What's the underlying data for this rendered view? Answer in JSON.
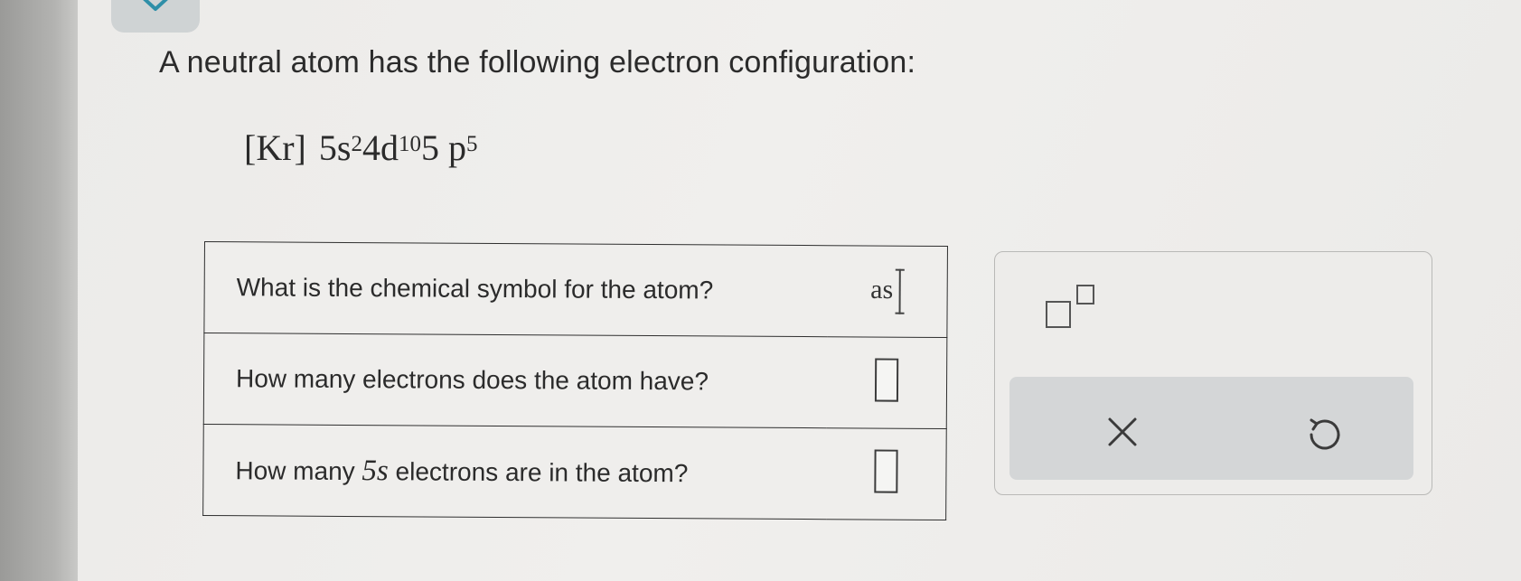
{
  "header": {
    "collapse_icon": "chevron-down-icon"
  },
  "question": {
    "prompt": "A neutral atom has the following electron configuration:",
    "configuration": {
      "core": "[Kr]",
      "orbitals": [
        {
          "label": "5s",
          "exponent": "2"
        },
        {
          "label": "4d",
          "exponent": "10"
        },
        {
          "label": "5 p",
          "exponent": "5"
        }
      ]
    }
  },
  "table": {
    "rows": [
      {
        "question": "What is the chemical symbol for the atom?",
        "answer": "as"
      },
      {
        "question": "How many electrons does the atom have?",
        "answer": ""
      },
      {
        "question_prefix": "How many ",
        "question_math": "5s",
        "question_suffix": " electrons are in the atom?",
        "answer": ""
      }
    ]
  },
  "tools": {
    "template_icon": "superscript-template-icon",
    "clear_icon": "x-icon",
    "undo_icon": "undo-icon"
  }
}
